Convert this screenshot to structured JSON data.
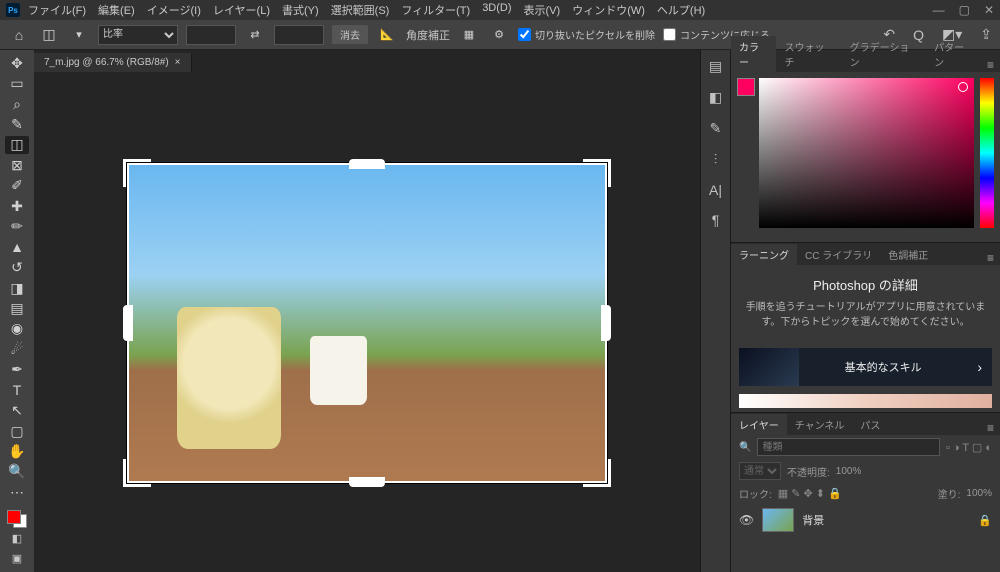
{
  "menubar": {
    "logo": "Ps",
    "items": [
      "ファイル(F)",
      "編集(E)",
      "イメージ(I)",
      "レイヤー(L)",
      "書式(Y)",
      "選択範囲(S)",
      "フィルター(T)",
      "3D(D)",
      "表示(V)",
      "ウィンドウ(W)",
      "ヘルプ(H)"
    ]
  },
  "optionsbar": {
    "ratio_label": "比率",
    "clear": "消去",
    "straighten": "角度補正",
    "delete_cropped": "切り抜いたピクセルを削除",
    "content_aware": "コンテンツに応じる"
  },
  "document": {
    "tab": "7_m.jpg @ 66.7% (RGB/8#)"
  },
  "color_panel": {
    "tabs": [
      "カラー",
      "スウォッチ",
      "グラデーション",
      "パターン"
    ]
  },
  "learning_panel": {
    "tabs": [
      "ラーニング",
      "CC ライブラリ",
      "色調補正"
    ],
    "title": "Photoshop の詳細",
    "desc": "手順を追うチュートリアルがアプリに用意されています。下からトピックを選んで始めてください。",
    "card": "基本的なスキル"
  },
  "layers_panel": {
    "tabs": [
      "レイヤー",
      "チャンネル",
      "パス"
    ],
    "search_placeholder": "種類",
    "blend": "通常",
    "opacity_label": "不透明度:",
    "opacity": "100%",
    "lock_label": "ロック:",
    "fill_label": "塗り:",
    "fill": "100%",
    "layer_name": "背景"
  }
}
